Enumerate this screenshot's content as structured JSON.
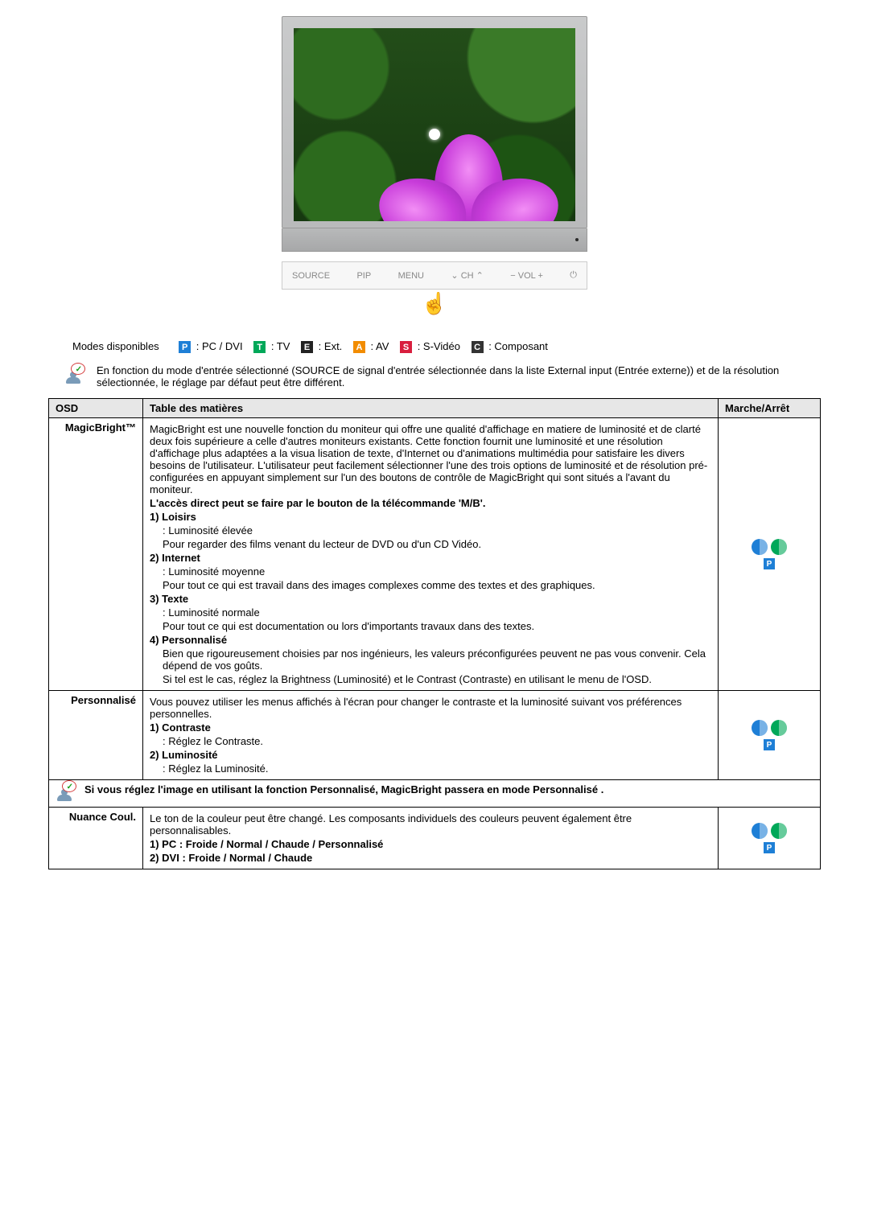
{
  "monitor": {
    "buttons": {
      "source": "SOURCE",
      "pip": "PIP",
      "menu": "MENU",
      "ch_down": "⌄",
      "ch_label": "CH",
      "ch_up": "⌃",
      "vol_down": "−",
      "vol_label": "VOL",
      "vol_up": "+",
      "power": "⏻"
    }
  },
  "modes": {
    "label": "Modes disponibles",
    "items": {
      "p": ": PC / DVI",
      "t": ": TV",
      "e": ": Ext.",
      "a": ": AV",
      "s": ": S-Vidéo",
      "c": ": Composant"
    },
    "letters": {
      "p": "P",
      "t": "T",
      "e": "E",
      "a": "A",
      "s": "S",
      "c": "C"
    }
  },
  "note_top": "En fonction du mode d'entrée sélectionné (SOURCE de signal d'entrée sélectionnée dans la liste External input (Entrée externe)) et de la résolution sélectionnée, le réglage par défaut peut être différent.",
  "table": {
    "headers": {
      "osd": "OSD",
      "toc": "Table des matières",
      "onoff": "Marche/Arrêt"
    },
    "rows": {
      "magicbright": {
        "label": "MagicBright™",
        "intro": "MagicBright est une nouvelle fonction du moniteur qui offre une qualité d'affichage en matiere de luminosité et de clarté deux fois supérieure a celle d'autres moniteurs existants. Cette fonction fournit une luminosité et une résolution d'affichage plus adaptées a la visua lisation de texte, d'Internet ou d'animations multimédia pour satisfaire les divers besoins de l'utilisateur. L'utilisateur peut facilement sélectionner l'une des trois options de luminosité et de résolution pré-configurées en appuyant simplement sur l'un des boutons de contrôle de MagicBright qui sont situés a l'avant du moniteur.",
        "direct": "L'accès direct peut se faire par le bouton de la télécommande 'M/B'.",
        "opt1_h": "1) Loisirs",
        "opt1_a": ": Luminosité élevée",
        "opt1_b": "Pour regarder des films venant du lecteur de DVD ou d'un CD Vidéo.",
        "opt2_h": "2) Internet",
        "opt2_a": ": Luminosité moyenne",
        "opt2_b": "Pour tout ce qui est travail dans des images complexes comme des textes et des graphiques.",
        "opt3_h": "3) Texte",
        "opt3_a": ": Luminosité normale",
        "opt3_b": "Pour tout ce qui est documentation ou lors d'importants travaux dans des textes.",
        "opt4_h": "4) Personnalisé",
        "opt4_a": "Bien que rigoureusement choisies par nos ingénieurs, les valeurs préconfigurées peuvent ne pas vous convenir. Cela dépend de vos goûts.",
        "opt4_b": "Si tel est le cas, réglez la Brightness (Luminosité) et le Contrast (Contraste) en utilisant le menu de l'OSD."
      },
      "personnalise": {
        "label": "Personnalisé",
        "intro": "Vous pouvez utiliser les menus affichés à l'écran pour changer le contraste et la luminosité suivant vos préférences personnelles.",
        "opt1_h": "1) Contraste",
        "opt1_a": ": Réglez le Contraste.",
        "opt2_h": "2) Luminosité",
        "opt2_a": ": Réglez la Luminosité."
      },
      "note_mid": "Si vous réglez l'image en utilisant la fonction Personnalisé, MagicBright passera en mode Personnalisé .",
      "nuance": {
        "label": "Nuance Coul.",
        "intro": "Le ton de la couleur peut être changé. Les composants individuels des couleurs peuvent également être personnalisables.",
        "opt1": "1) PC : Froide / Normal / Chaude / Personnalisé",
        "opt2": "2) DVI : Froide / Normal / Chaude"
      }
    }
  }
}
